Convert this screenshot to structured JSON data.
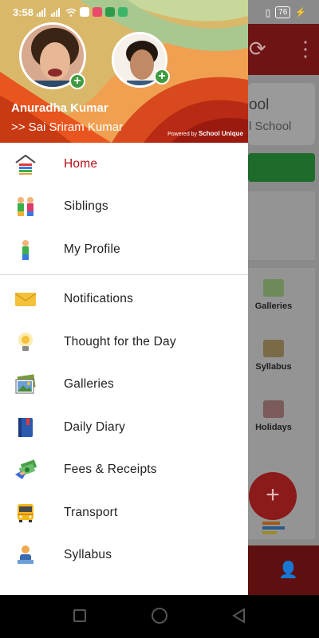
{
  "status_bar": {
    "time": "3:58",
    "battery": "76"
  },
  "drawer": {
    "header": {
      "user_name": "Anuradha Kumar",
      "child_name": ">> Sai Sriram Kumar",
      "powered_by_prefix": "Powered by",
      "powered_by_brand": "School Unique"
    },
    "menu_primary": [
      {
        "label": "Home",
        "icon": "home-icon",
        "active": true
      },
      {
        "label": "Siblings",
        "icon": "siblings-icon",
        "active": false
      },
      {
        "label": "My Profile",
        "icon": "profile-icon",
        "active": false
      }
    ],
    "menu_secondary": [
      {
        "label": "Notifications",
        "icon": "envelope-icon"
      },
      {
        "label": "Thought for the Day",
        "icon": "lightbulb-icon"
      },
      {
        "label": "Galleries",
        "icon": "gallery-icon"
      },
      {
        "label": "Daily Diary",
        "icon": "diary-icon"
      },
      {
        "label": "Fees & Receipts",
        "icon": "money-icon"
      },
      {
        "label": "Transport",
        "icon": "bus-icon"
      },
      {
        "label": "Syllabus",
        "icon": "syllabus-icon"
      }
    ]
  },
  "background_app": {
    "title_fragment": "ool",
    "subtitle_fragment": "l School",
    "grid": [
      {
        "label": "Galleries"
      },
      {
        "label": "Syllabus"
      },
      {
        "label": "Holidays"
      }
    ],
    "fab_symbol": "+"
  },
  "colors": {
    "accent": "#b3101b",
    "header_orange": "#e8551e",
    "green_add": "#3f9b3f"
  }
}
